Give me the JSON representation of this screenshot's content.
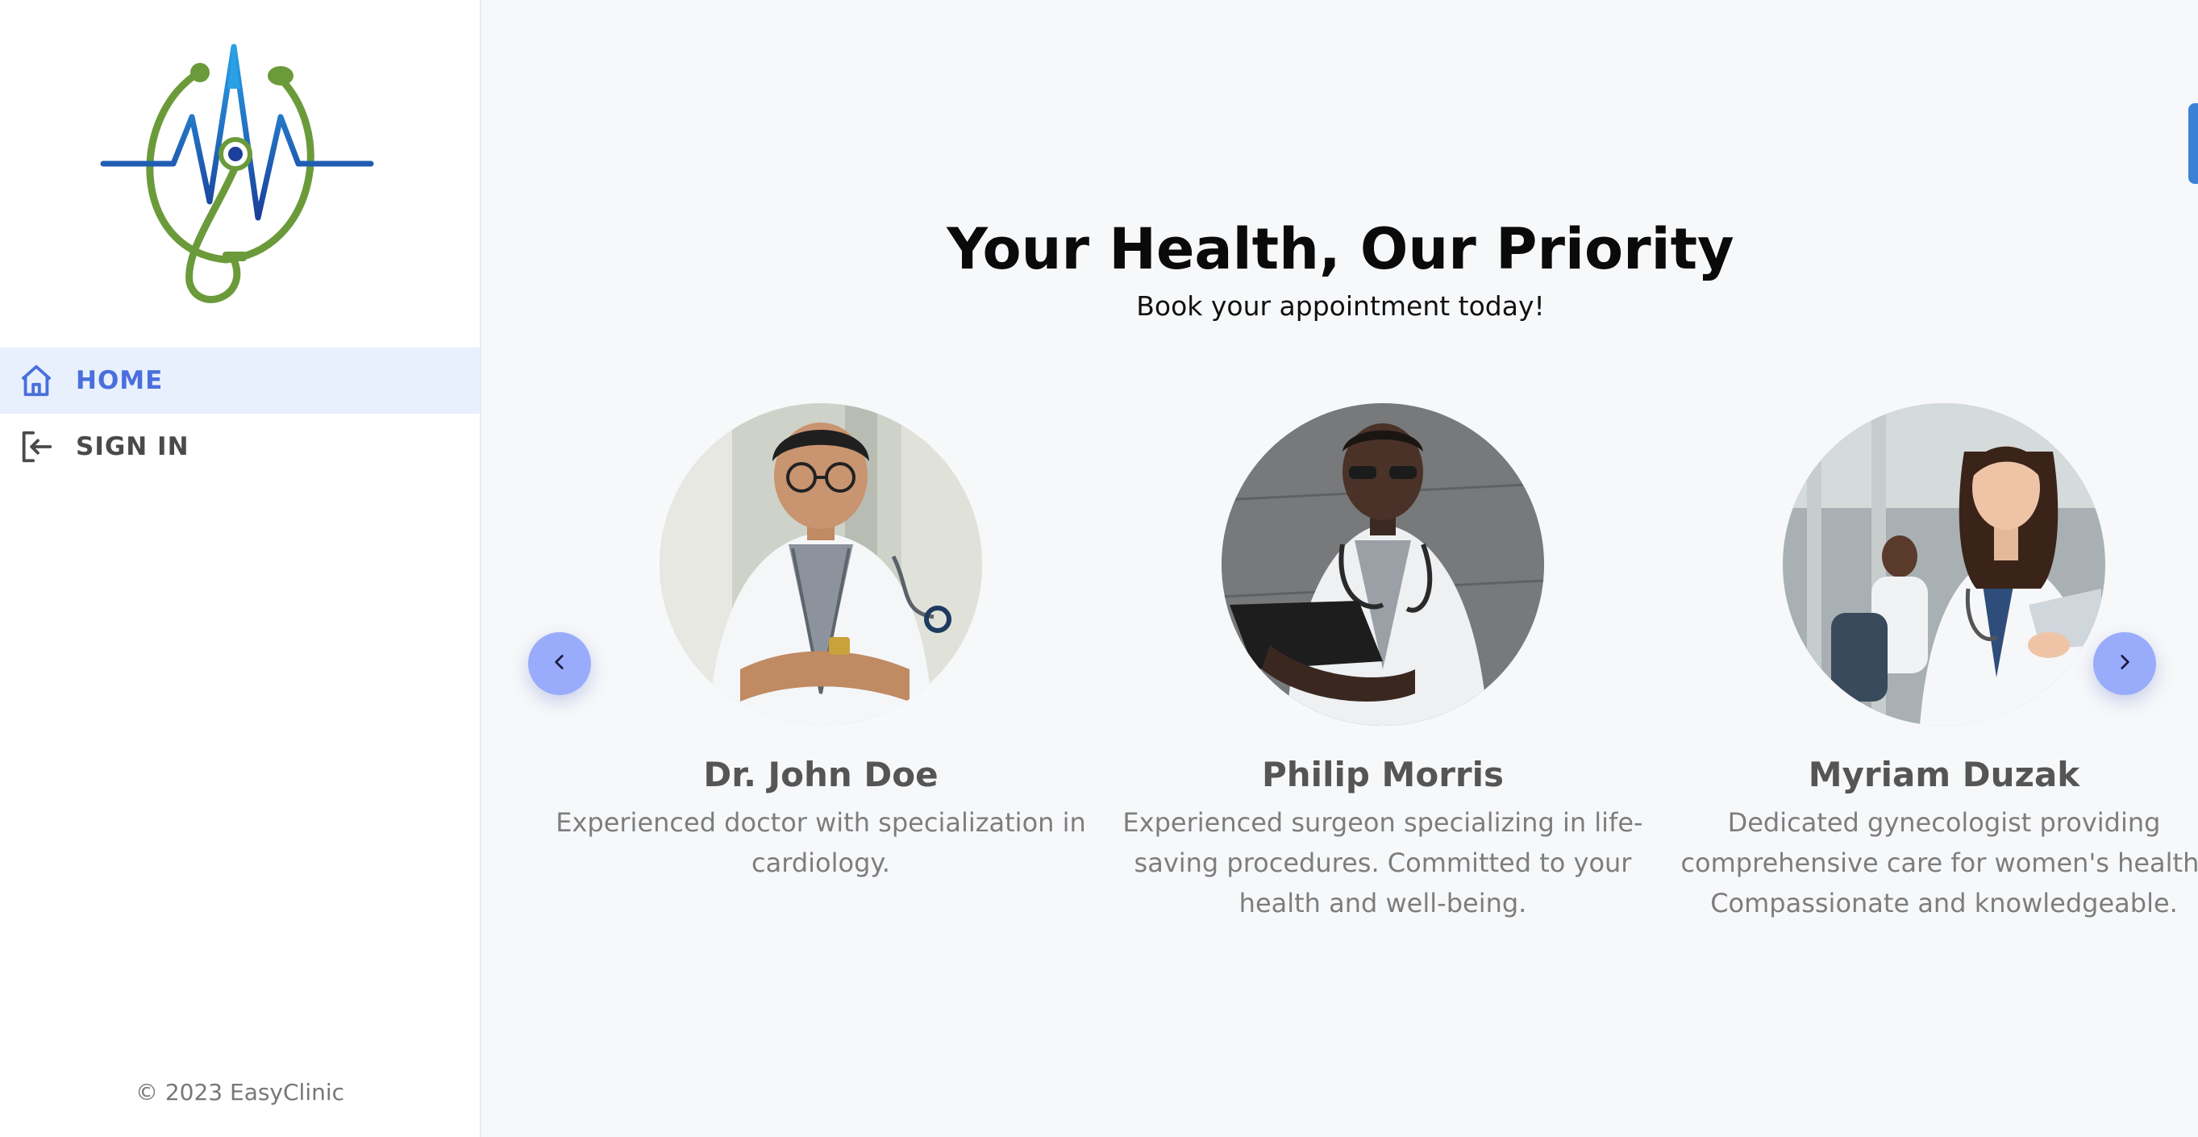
{
  "sidebar": {
    "logo_icon": "stethoscope-heartbeat-logo",
    "nav": [
      {
        "label": "HOME",
        "icon": "home-icon",
        "active": true
      },
      {
        "label": "SIGN IN",
        "icon": "sign-in-icon",
        "active": false
      }
    ],
    "footer": "© 2023 EasyClinic"
  },
  "hero": {
    "title": "Your Health, Our Priority",
    "subtitle": "Book your appointment today!"
  },
  "carousel": {
    "prev_icon": "chevron-left-icon",
    "next_icon": "chevron-right-icon",
    "doctors": [
      {
        "name": "Dr. John Doe",
        "description": "Experienced doctor with specialization in cardiology."
      },
      {
        "name": "Philip Morris",
        "description": "Experienced surgeon specializing in life-saving procedures. Committed to your health and well-being."
      },
      {
        "name": "Myriam Duzak",
        "description": "Dedicated gynecologist providing comprehensive care for women's health. Compassionate and knowledgeable."
      }
    ]
  },
  "colors": {
    "accent": "#4a6fdc",
    "active_bg": "#e8f0fe",
    "arrow_bg": "#99abfb",
    "logo_green": "#6b9a3a",
    "logo_blue": "#1e5bb8"
  }
}
